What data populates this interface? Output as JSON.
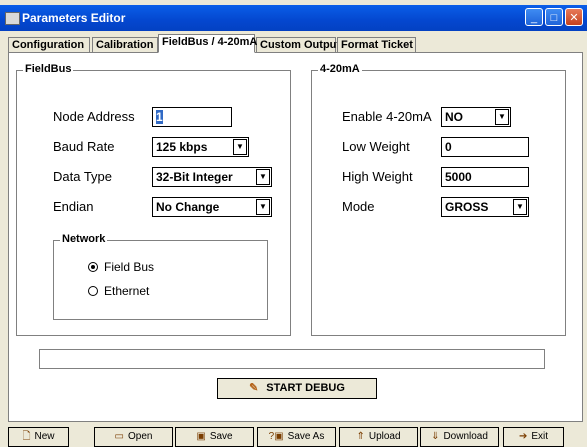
{
  "window": {
    "title": "Parameters Editor",
    "buttons": [
      {
        "name": "minimize",
        "glyph": "_"
      },
      {
        "name": "maximize",
        "glyph": "□"
      },
      {
        "name": "close",
        "glyph": "✕"
      }
    ]
  },
  "tabs": [
    {
      "label": "Configuration",
      "active": false
    },
    {
      "label": "Calibration",
      "active": false
    },
    {
      "label": "FieldBus / 4-20mA",
      "active": true
    },
    {
      "label": "Custom Output",
      "active": false
    },
    {
      "label": "Format Ticket",
      "active": false
    }
  ],
  "fieldbus": {
    "title": "FieldBus",
    "node_address_label": "Node Address",
    "node_address_value": "1",
    "baud_rate_label": "Baud Rate",
    "baud_rate_value": "125 kbps",
    "data_type_label": "Data Type",
    "data_type_value": "32-Bit Integer",
    "endian_label": "Endian",
    "endian_value": "No Change",
    "network": {
      "title": "Network",
      "options": [
        {
          "label": "Field Bus",
          "selected": true
        },
        {
          "label": "Ethernet",
          "selected": false
        }
      ]
    }
  },
  "analog": {
    "title": "4-20mA",
    "enable_label": "Enable 4-20mA",
    "enable_value": "NO",
    "low_weight_label": "Low Weight",
    "low_weight_value": "0",
    "high_weight_label": "High Weight",
    "high_weight_value": "5000",
    "mode_label": "Mode",
    "mode_value": "GROSS"
  },
  "debug_button": {
    "label": "START DEBUG",
    "icon": "wrench-icon"
  },
  "toolbar": [
    {
      "label": "New",
      "icon": "new-file-icon"
    },
    {
      "label": "Open",
      "icon": "open-folder-icon"
    },
    {
      "label": "Save",
      "icon": "save-icon"
    },
    {
      "label": "Save As",
      "icon": "save-as-icon"
    },
    {
      "label": "Upload",
      "icon": "upload-icon"
    },
    {
      "label": "Download",
      "icon": "download-icon"
    },
    {
      "label": "Exit",
      "icon": "exit-icon"
    }
  ],
  "colors": {
    "title_bar": "#0447cf",
    "face": "#ece9d8",
    "selection": "#316ac5"
  }
}
